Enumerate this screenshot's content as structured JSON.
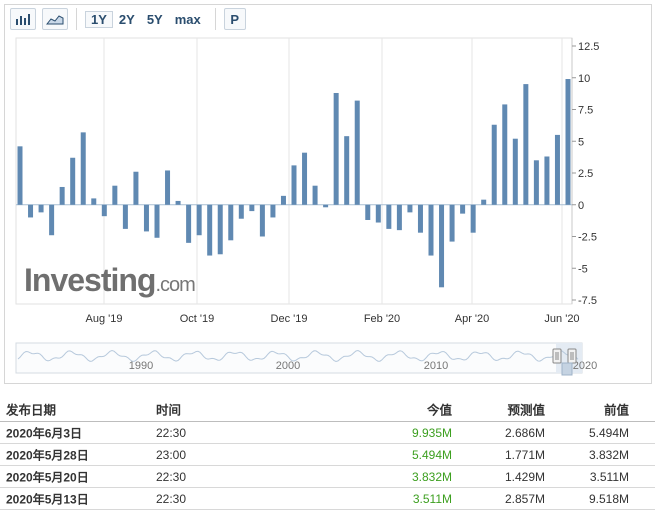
{
  "toolbar": {
    "icons": [
      "bar-chart-icon",
      "area-chart-icon"
    ],
    "ranges": [
      "1Y",
      "2Y",
      "5Y",
      "max"
    ],
    "active_range": "1Y",
    "p_label": "P"
  },
  "watermark": {
    "brand": "Investing",
    "suffix": ".com"
  },
  "navigator": {
    "labels": [
      "1990",
      "2000",
      "2010",
      "2020"
    ]
  },
  "chart_data": {
    "type": "bar",
    "title": "",
    "xlabel": "",
    "ylabel": "",
    "ylim": [
      -7.5,
      12.5
    ],
    "y_ticks": [
      "12.5",
      "10",
      "7.5",
      "5",
      "2.5",
      "0",
      "-2.5",
      "-5",
      "-7.5"
    ],
    "x_ticks": [
      "Aug '19",
      "Oct '19",
      "Dec '19",
      "Feb '20",
      "Apr '20",
      "Jun '20"
    ],
    "bar_color": "#6089b2",
    "values": [
      4.6,
      -1.0,
      -0.6,
      -2.4,
      1.4,
      3.7,
      5.7,
      0.5,
      -0.9,
      1.5,
      -1.9,
      2.6,
      -2.1,
      -2.6,
      2.7,
      0.3,
      -3.0,
      -2.4,
      -4.0,
      -3.9,
      -2.8,
      -1.1,
      -0.5,
      -2.5,
      -1.0,
      0.7,
      3.1,
      4.1,
      1.5,
      -0.2,
      8.8,
      5.4,
      8.2,
      -1.2,
      -1.4,
      -1.9,
      -2.0,
      -0.6,
      -2.2,
      -4.0,
      -6.5,
      -2.9,
      -0.7,
      -2.2,
      0.4,
      6.3,
      7.9,
      5.2,
      9.5,
      3.5,
      3.8,
      5.5,
      9.9
    ]
  },
  "table": {
    "headers": {
      "date": "发布日期",
      "time": "时间",
      "actual": "今值",
      "forecast": "预测值",
      "previous": "前值"
    },
    "rows": [
      {
        "date": "2020年6月3日",
        "time": "22:30",
        "actual": "9.935M",
        "forecast": "2.686M",
        "previous": "5.494M"
      },
      {
        "date": "2020年5月28日",
        "time": "23:00",
        "actual": "5.494M",
        "forecast": "1.771M",
        "previous": "3.832M"
      },
      {
        "date": "2020年5月20日",
        "time": "22:30",
        "actual": "3.832M",
        "forecast": "1.429M",
        "previous": "3.511M"
      },
      {
        "date": "2020年5月13日",
        "time": "22:30",
        "actual": "3.511M",
        "forecast": "2.857M",
        "previous": "9.518M"
      }
    ]
  }
}
